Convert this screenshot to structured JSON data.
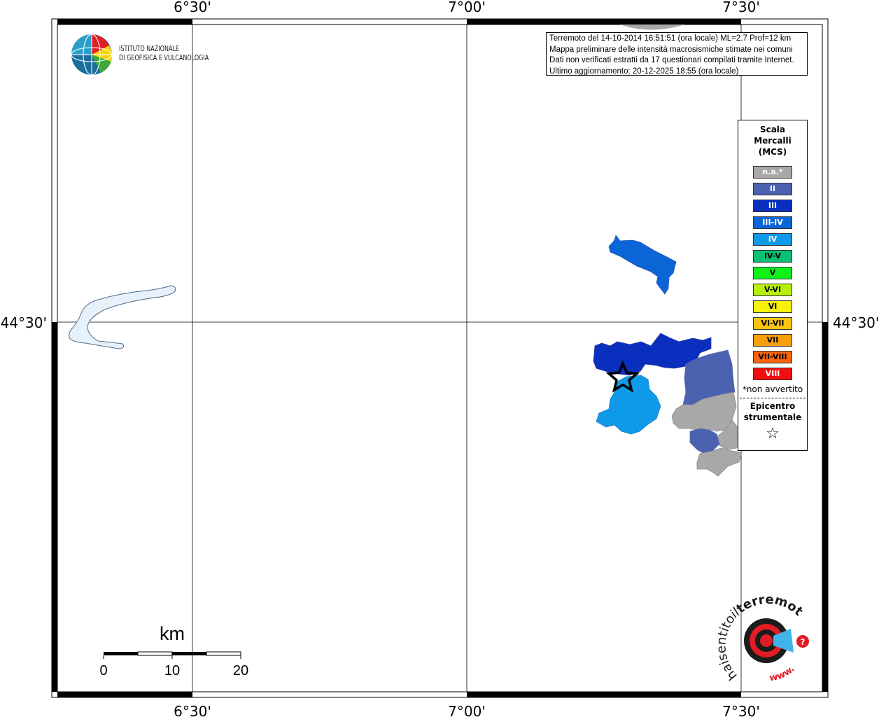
{
  "map": {
    "top_labels": [
      "6°30'",
      "7°00'",
      "7°30'"
    ],
    "bottom_labels": [
      "6°30'",
      "7°00'",
      "7°30'"
    ],
    "left_label": "44°30'",
    "right_label": "44°30'"
  },
  "info": {
    "line1": "Terremoto del 14-10-2014 16:51:51 (ora locale) ML=2.7 Prof=12 km",
    "line2": "Mappa preliminare delle intensità macrosismiche stimate nei comuni",
    "line3": "Dati non verificati estratti da 17 questionari compilati tramite Internet.",
    "line4": "Ultimo aggiornamento: 20-12-2025 18:55 (ora locale)"
  },
  "logo": {
    "line1": "ISTITUTO NAZIONALE",
    "line2": "DI GEOFISICA E VULCANOLOGIA"
  },
  "legend": {
    "title_line1": "Scala",
    "title_line2": "Mercalli",
    "title_line3": "(MCS)",
    "items": [
      {
        "label": "n.a.*",
        "color": "#a8a8a8",
        "text_color": "#ffffff"
      },
      {
        "label": "II",
        "color": "#4a62b0",
        "text_color": "#ffffff"
      },
      {
        "label": "III",
        "color": "#0a2fbf",
        "text_color": "#ffffff"
      },
      {
        "label": "III-IV",
        "color": "#0a66d6",
        "text_color": "#ffffff"
      },
      {
        "label": "IV",
        "color": "#0e9ae8",
        "text_color": "#ffffff"
      },
      {
        "label": "IV-V",
        "color": "#0bbf74",
        "text_color": "#000000"
      },
      {
        "label": "V",
        "color": "#0ef01a",
        "text_color": "#000000"
      },
      {
        "label": "V-VI",
        "color": "#b7ef0a",
        "text_color": "#000000"
      },
      {
        "label": "VI",
        "color": "#f6f00a",
        "text_color": "#000000"
      },
      {
        "label": "VI-VII",
        "color": "#f7c50c",
        "text_color": "#000000"
      },
      {
        "label": "VII",
        "color": "#f7a00c",
        "text_color": "#000000"
      },
      {
        "label": "VII-VIII",
        "color": "#f7650c",
        "text_color": "#000000"
      },
      {
        "label": "VIII",
        "color": "#f20e0e",
        "text_color": "#ffffff"
      }
    ],
    "note": "*non avvertito",
    "epi_line1": "Epicentro",
    "epi_line2": "strumentale",
    "star": "☆"
  },
  "scalebar": {
    "unit": "km",
    "ticks": [
      "0",
      "10",
      "20"
    ]
  },
  "brand": {
    "word_left": "haisentito",
    "word_il": "il",
    "word_right": "terremoto.it",
    "www": "www.",
    "qmark": "?"
  },
  "colors": {
    "frame": "#000000",
    "lake": "#e6f1fb",
    "lake_edge": "#4d6d8a",
    "region_edge": "#5a6fa8"
  }
}
